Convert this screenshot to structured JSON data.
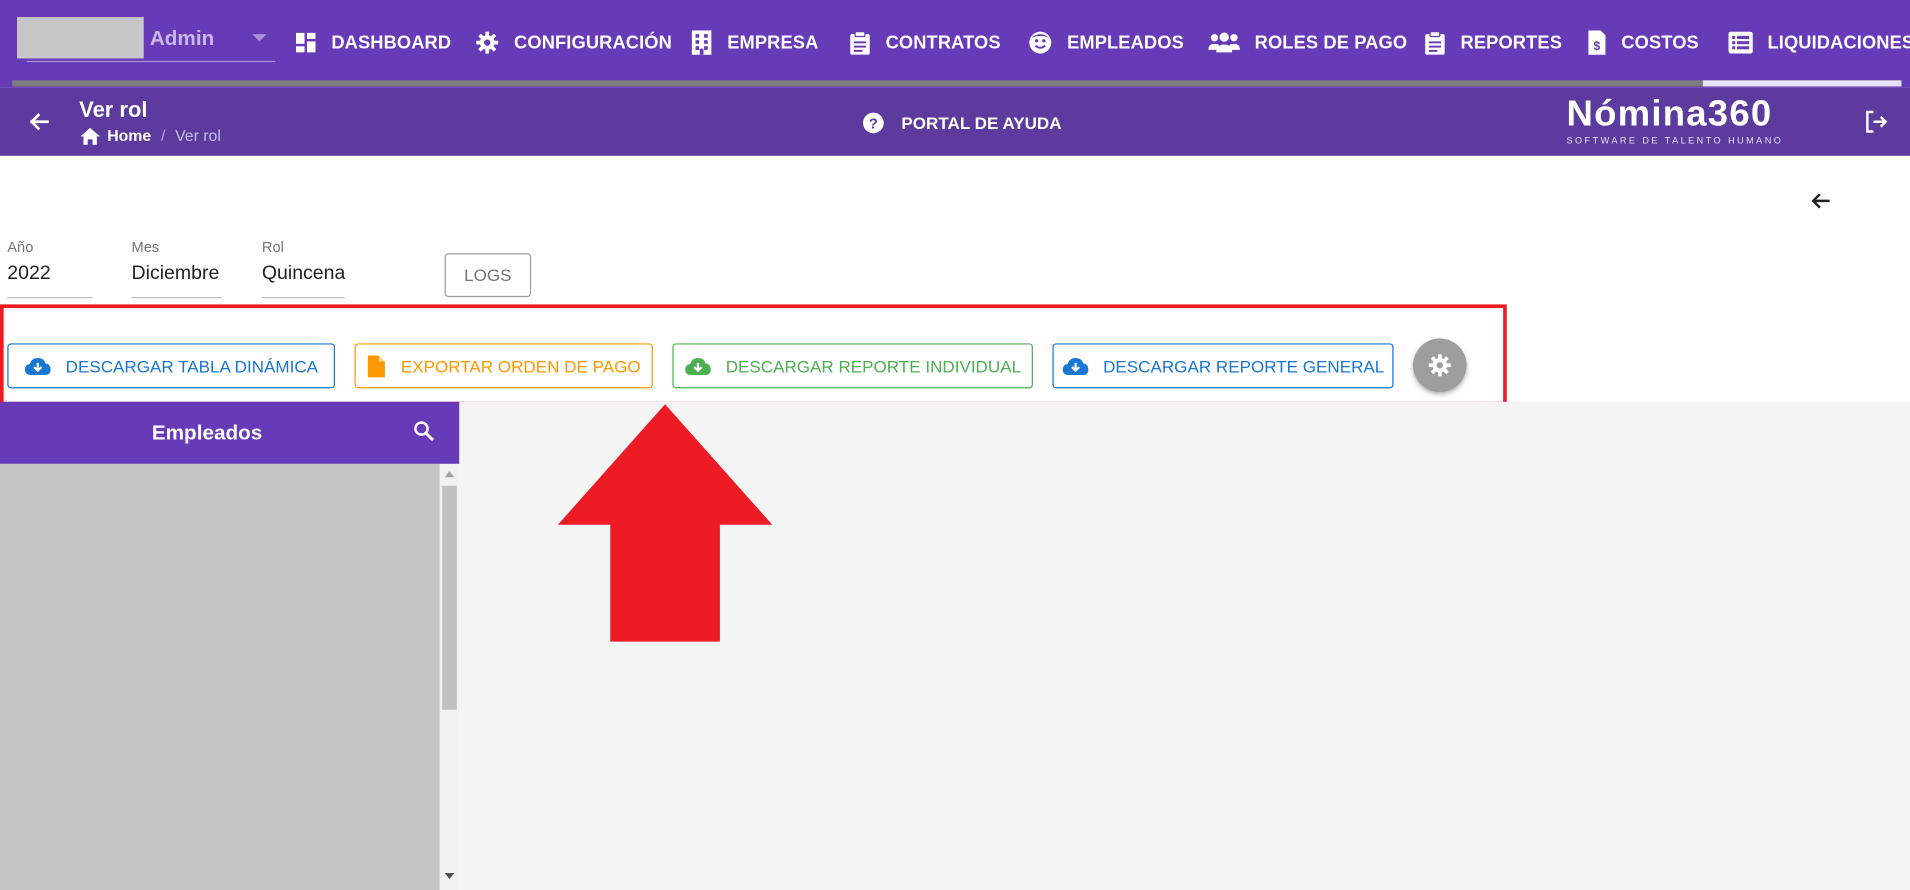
{
  "user": {
    "name": "Admin"
  },
  "nav": {
    "items": [
      {
        "label": "DASHBOARD",
        "icon": "dashboard-icon"
      },
      {
        "label": "CONFIGURACIÓN",
        "icon": "gear-icon"
      },
      {
        "label": "EMPRESA",
        "icon": "building-icon"
      },
      {
        "label": "CONTRATOS",
        "icon": "clipboard-icon"
      },
      {
        "label": "EMPLEADOS",
        "icon": "face-icon"
      },
      {
        "label": "ROLES DE PAGO",
        "icon": "people-icon"
      },
      {
        "label": "REPORTES",
        "icon": "clipboard-icon"
      },
      {
        "label": "COSTOS",
        "icon": "invoice-dollar-icon"
      },
      {
        "label": "LIQUIDACIONES",
        "icon": "list-icon"
      }
    ]
  },
  "header": {
    "title": "Ver rol",
    "breadcrumb": {
      "home": "Home",
      "separator": "/",
      "current": "Ver rol"
    },
    "help_label": "PORTAL DE AYUDA",
    "brand": {
      "name": "Nómina360",
      "tagline": "SOFTWARE DE TALENTO HUMANO"
    }
  },
  "filters": {
    "year": {
      "label": "Año",
      "value": "2022"
    },
    "month": {
      "label": "Mes",
      "value": "Diciembre"
    },
    "role": {
      "label": "Rol",
      "value": "Quincena"
    },
    "logs_label": "LOGS"
  },
  "actions": {
    "pivot": {
      "label": "DESCARGAR TABLA DINÁMICA",
      "color": "#1976d2",
      "icon": "cloud-download-icon"
    },
    "payment_order": {
      "label": "EXPORTAR ORDEN DE PAGO",
      "color": "#ff9800",
      "icon": "file-icon"
    },
    "individual": {
      "label": "DESCARGAR REPORTE INDIVIDUAL",
      "color": "#4caf50",
      "icon": "cloud-download-icon"
    },
    "general": {
      "label": "DESCARGAR REPORTE GENERAL",
      "color": "#1976d2",
      "icon": "cloud-download-icon"
    },
    "settings_icon": "gear-icon"
  },
  "employees_panel": {
    "title": "Empleados"
  },
  "colors": {
    "primary": "#673ab7",
    "subheader": "#5c3a9e",
    "highlight": "#ed1c24",
    "main_bg": "#f4f4f4"
  }
}
